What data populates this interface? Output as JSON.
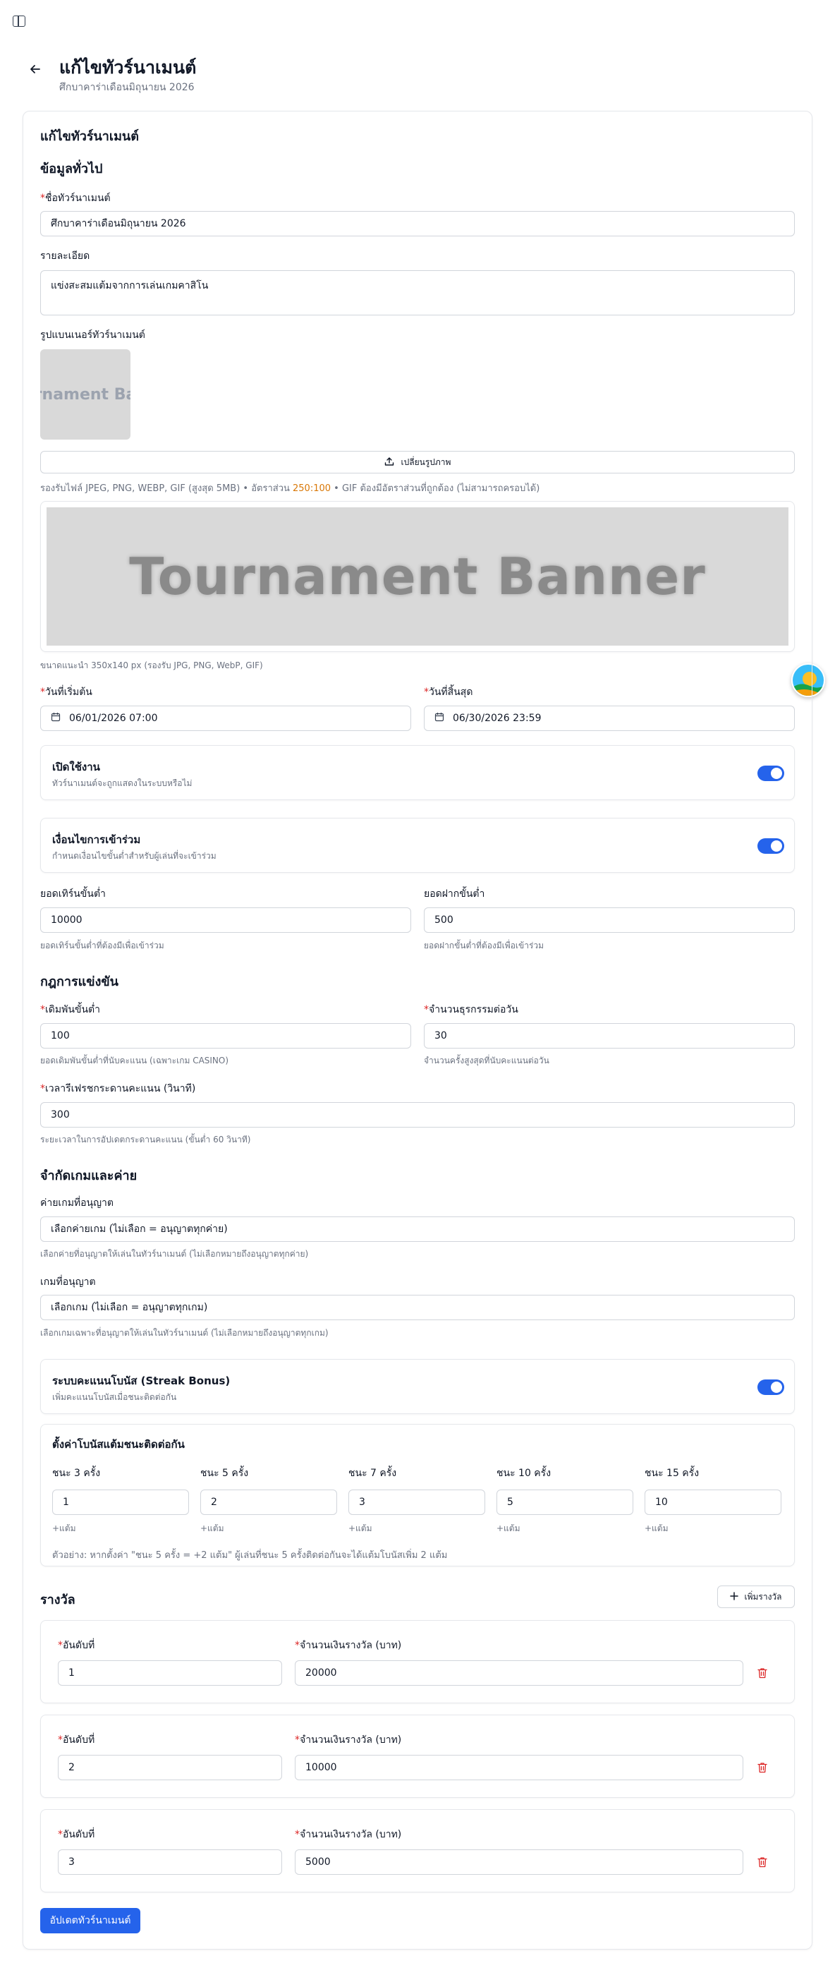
{
  "header": {
    "title": "แก้ไขทัวร์นาเมนต์",
    "subtitle": "ศึกบาคาร่าเดือนมิถุนายน 2026"
  },
  "card": {
    "title": "แก้ไขทัวร์นาเมนต์"
  },
  "general": {
    "section_title": "ข้อมูลทั่วไป",
    "name_label": "ชื่อทัวร์นาเมนต์",
    "name_value": "ศึกบาคาร่าเดือนมิถุนายน 2026",
    "desc_label": "รายละเอียด",
    "desc_value": "แข่งสะสมแต้มจากการเล่นเกมคาสิโน",
    "banner_label": "รูปแบนเนอร์ทัวร์นาเมนต์",
    "banner_thumb_text": "urnament Ban",
    "upload_label": "เปลี่ยนรูปภาพ",
    "upload_hint_pre": "รองรับไฟล์ JPEG, PNG, WEBP, GIF (สูงสุด 5MB) • อัตราส่วน ",
    "upload_hint_ratio": "250:100",
    "upload_hint_post": " • GIF ต้องมีอัตราส่วนที่ถูกต้อง (ไม่สามารถครอบได้)",
    "banner_preview_text": "Tournament Banner",
    "banner_size_hint": "ขนาดแนะนำ 350x140 px (รองรับ JPG, PNG, WebP, GIF)",
    "start_label": "วันที่เริ่มต้น",
    "start_value": "06/01/2026 07:00",
    "end_label": "วันที่สิ้นสุด",
    "end_value": "06/30/2026 23:59",
    "enable_title": "เปิดใช้งาน",
    "enable_sub": "ทัวร์นาเมนต์จะถูกแสดงในระบบหรือไม่",
    "enable_on": true,
    "cond_title": "เงื่อนไขการเข้าร่วม",
    "cond_sub": "กำหนดเงื่อนไขขั้นต่ำสำหรับผู้เล่นที่จะเข้าร่วม",
    "cond_on": true,
    "min_turnover_label": "ยอดเทิร์นขั้นต่ำ",
    "min_turnover_value": "10000",
    "min_turnover_hint": "ยอดเทิร์นขั้นต่ำที่ต้องมีเพื่อเข้าร่วม",
    "min_deposit_label": "ยอดฝากขั้นต่ำ",
    "min_deposit_value": "500",
    "min_deposit_hint": "ยอดฝากขั้นต่ำที่ต้องมีเพื่อเข้าร่วม"
  },
  "rules": {
    "section_title": "กฎการแข่งขัน",
    "min_bet_label": "เดิมพันขั้นต่ำ",
    "min_bet_value": "100",
    "min_bet_hint": "ยอดเดิมพันขั้นต่ำที่นับคะแนน (เฉพาะเกม CASINO)",
    "tx_label": "จำนวนธุรกรรมต่อวัน",
    "tx_value": "30",
    "tx_hint": "จำนวนครั้งสูงสุดที่นับคะแนนต่อวัน",
    "refresh_label": "เวลารีเฟรชกระดานคะแนน (วินาที)",
    "refresh_value": "300",
    "refresh_hint": "ระยะเวลาในการอัปเดตกระดานคะแนน (ขั้นต่ำ 60 วินาที)"
  },
  "limits": {
    "section_title": "จำกัดเกมและค่าย",
    "provider_label": "ค่ายเกมที่อนุญาต",
    "provider_value": "เลือกค่ายเกม (ไม่เลือก = อนุญาตทุกค่าย)",
    "provider_hint": "เลือกค่ายที่อนุญาตให้เล่นในทัวร์นาเมนต์ (ไม่เลือกหมายถึงอนุญาตทุกค่าย)",
    "game_label": "เกมที่อนุญาต",
    "game_value": "เลือกเกม (ไม่เลือก = อนุญาตทุกเกม)",
    "game_hint": "เลือกเกมเฉพาะที่อนุญาตให้เล่นในทัวร์นาเมนต์ (ไม่เลือกหมายถึงอนุญาตทุกเกม)",
    "streak_title": "ระบบคะแนนโบนัส (Streak Bonus)",
    "streak_sub": "เพิ่มคะแนนโบนัสเมื่อชนะติดต่อกัน",
    "streak_on": true,
    "streak_panel_title": "ตั้งค่าโบนัสแต้มชนะติดต่อกัน",
    "streak_items": [
      {
        "label": "ชนะ 3 ครั้ง",
        "value": "1",
        "hint": "+แต้ม"
      },
      {
        "label": "ชนะ 5 ครั้ง",
        "value": "2",
        "hint": "+แต้ม"
      },
      {
        "label": "ชนะ 7 ครั้ง",
        "value": "3",
        "hint": "+แต้ม"
      },
      {
        "label": "ชนะ 10 ครั้ง",
        "value": "5",
        "hint": "+แต้ม"
      },
      {
        "label": "ชนะ 15 ครั้ง",
        "value": "10",
        "hint": "+แต้ม"
      }
    ],
    "streak_example": "ตัวอย่าง: หากตั้งค่า \"ชนะ 5 ครั้ง = +2 แต้ม\" ผู้เล่นที่ชนะ 5 ครั้งติดต่อกันจะได้แต้มโบนัสเพิ่ม 2 แต้ม"
  },
  "prizes": {
    "section_title": "รางวัล",
    "add_label": "เพิ่มรางวัล",
    "rank_label": "อันดับที่",
    "amount_label": "จำนวนเงินรางวัล (บาท)",
    "items": [
      {
        "rank": "1",
        "amount": "20000"
      },
      {
        "rank": "2",
        "amount": "10000"
      },
      {
        "rank": "3",
        "amount": "5000"
      }
    ]
  },
  "submit_label": "อัปเดตทัวร์นาเมนต์",
  "colors": {
    "primary": "#2563eb",
    "danger": "#dc2626",
    "accent": "#d97706"
  }
}
